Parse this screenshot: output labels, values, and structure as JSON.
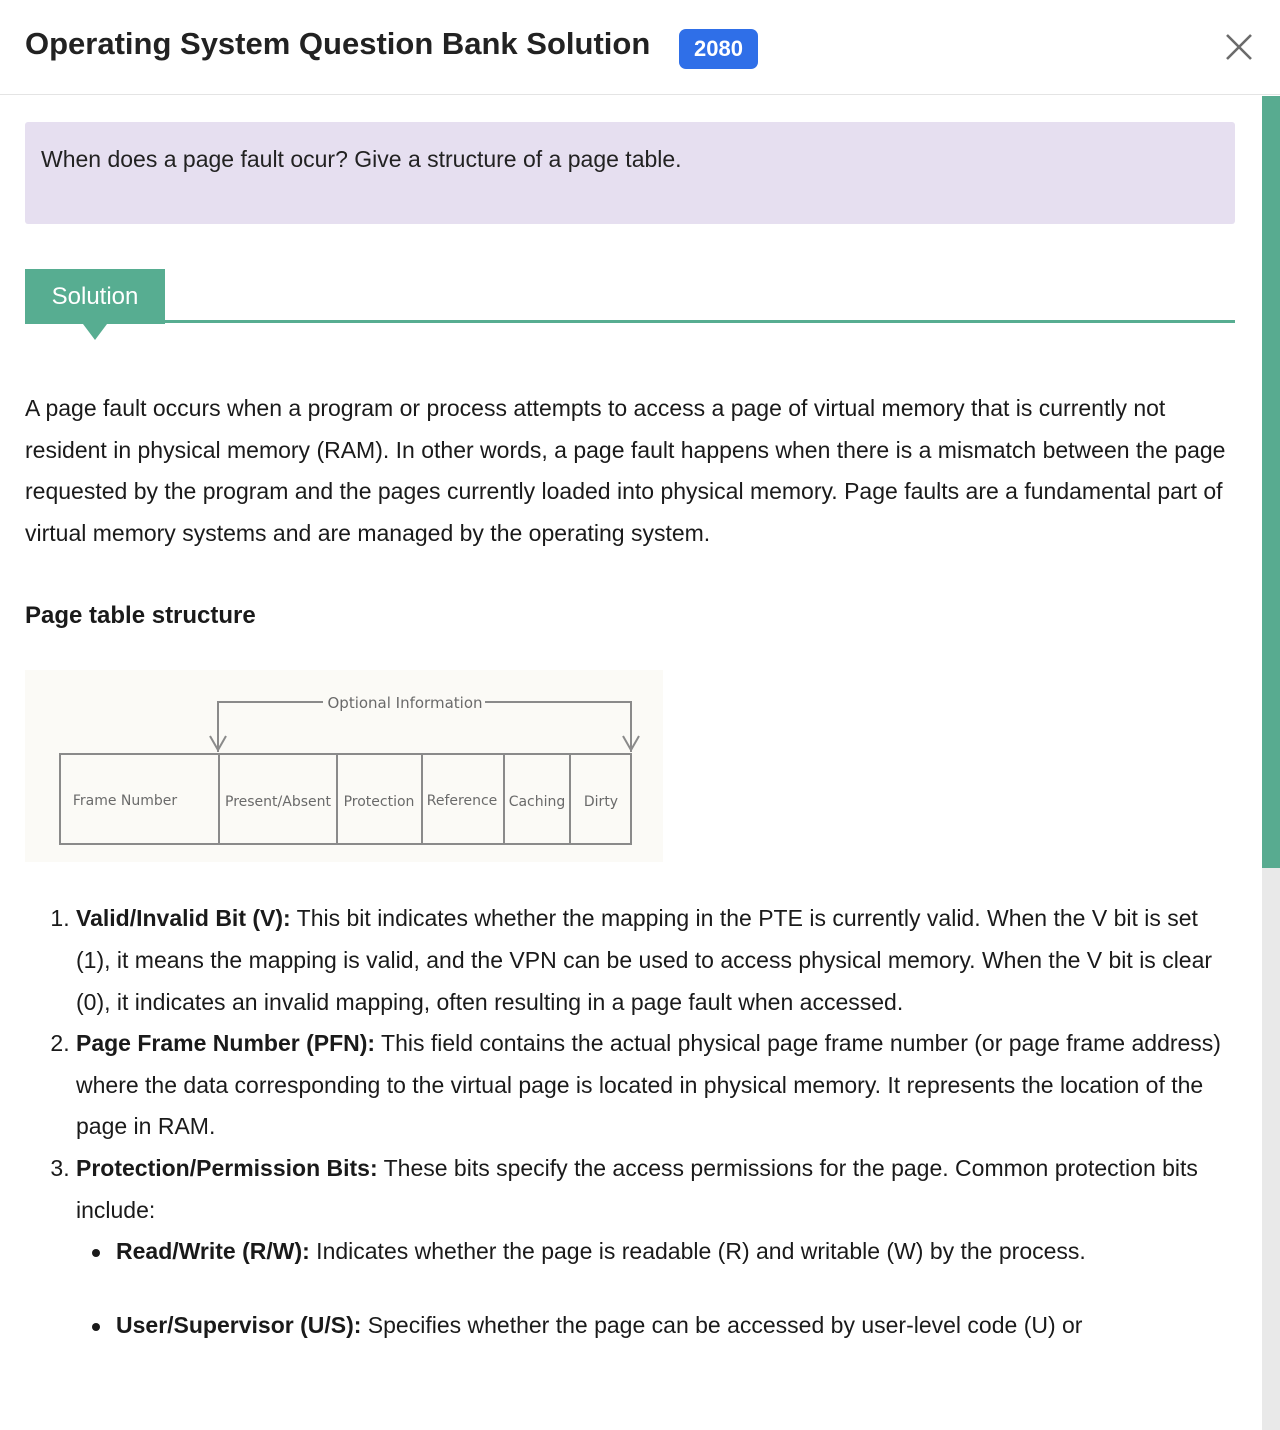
{
  "header": {
    "title": "Operating System Question Bank Solution",
    "badge": "2080",
    "close_icon": "close-icon"
  },
  "question": {
    "text": "When does a page fault ocur? Give a structure of a page table."
  },
  "solution": {
    "tab_label": "Solution",
    "intro": "A page fault occurs when a program or process attempts to access a page of virtual memory that is currently not resident in physical memory (RAM). In other words, a page fault happens when there is a mismatch between the page requested by the program and the pages currently loaded into physical memory. Page faults are a fundamental part of virtual memory systems and are managed by the operating system.",
    "subheading": "Page table structure",
    "diagram": {
      "optional_label": "Optional Information",
      "cells": [
        "Frame Number",
        "Present/Absent",
        "Protection",
        "Reference",
        "Caching",
        "Dirty"
      ]
    },
    "items": [
      {
        "term": "Valid/Invalid Bit (V):",
        "desc": " This bit indicates whether the mapping in the PTE is currently valid. When the V bit is set (1), it means the mapping is valid, and the VPN can be used to access physical memory. When the V bit is clear (0), it indicates an invalid mapping, often resulting in a page fault when accessed."
      },
      {
        "term": "Page Frame Number (PFN):",
        "desc": " This field contains the actual physical page frame number (or page frame address) where the data corresponding to the virtual page is located in physical memory. It represents the location of the page in RAM."
      },
      {
        "term": "Protection/Permission Bits:",
        "desc": " These bits specify the access permissions for the page. Common protection bits include:",
        "subitems": [
          {
            "term": "Read/Write (R/W):",
            "desc": " Indicates whether the page is readable (R) and writable (W) by the process."
          },
          {
            "term": "User/Supervisor (U/S):",
            "desc": " Specifies whether the page can be accessed by user-level code (U) or"
          }
        ]
      }
    ]
  },
  "colors": {
    "accent_green": "#57ad91",
    "badge_blue": "#2f6fe8",
    "question_bg": "#e6dff0"
  }
}
